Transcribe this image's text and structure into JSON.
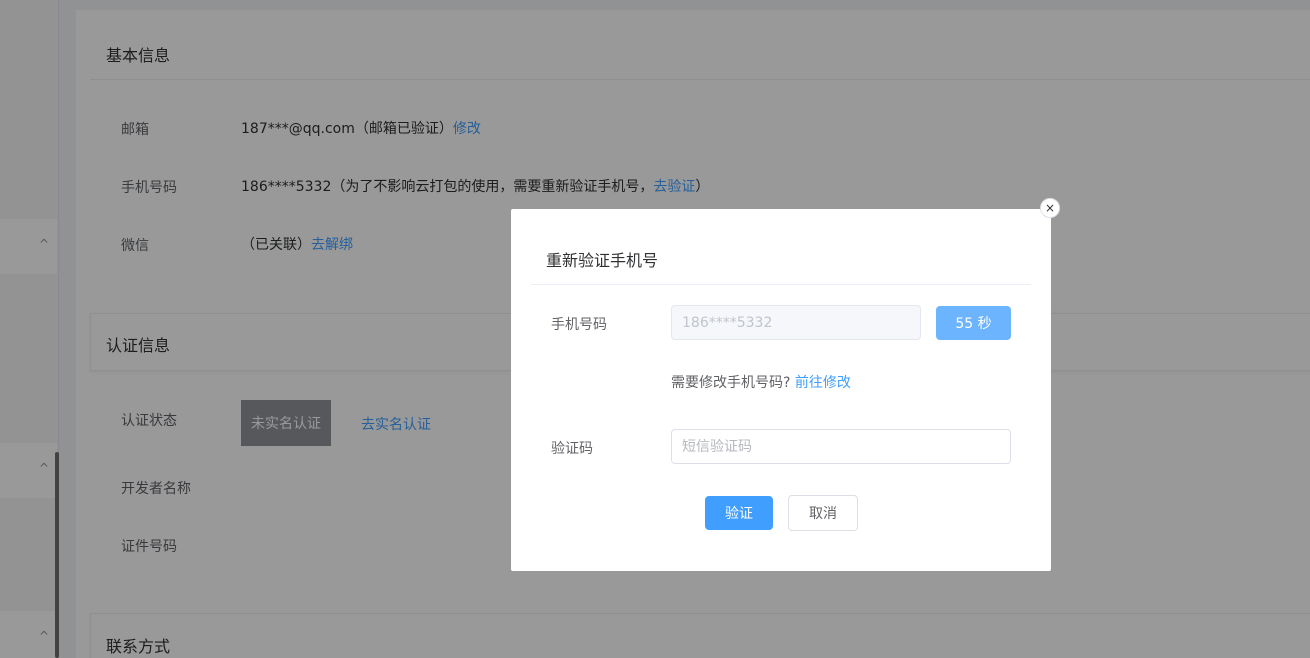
{
  "basic_info": {
    "title": "基本信息",
    "email": {
      "label": "邮箱",
      "value": "187***@qq.com",
      "status": "（邮箱已验证）",
      "action": "修改"
    },
    "phone": {
      "label": "手机号码",
      "value": "186****5332",
      "note_prefix": "（为了不影响云打包的使用，需要重新验证手机号，",
      "action": "去验证",
      "note_suffix": "）"
    },
    "wechat": {
      "label": "微信",
      "status": "（已关联）",
      "action": "去解绑"
    }
  },
  "cert_info": {
    "title": "认证信息",
    "status_label": "认证状态",
    "status_value": "未实名认证",
    "status_action": "去实名认证",
    "developer_label": "开发者名称",
    "id_label": "证件号码"
  },
  "contact": {
    "title": "联系方式"
  },
  "sidebar": {
    "chevrons": [
      "^",
      "^",
      "^"
    ]
  },
  "dialog": {
    "title": "重新验证手机号",
    "close_glyph": "×",
    "phone_label": "手机号码",
    "phone_value": "186****5332",
    "countdown_label": "55 秒",
    "hint_text": "需要修改手机号码?",
    "hint_link": "前往修改",
    "code_label": "验证码",
    "code_placeholder": "短信验证码",
    "code_value": "",
    "confirm_label": "验证",
    "cancel_label": "取消"
  },
  "colors": {
    "accent": "#409eff",
    "overlay": "rgba(0,0,0,0.4)",
    "status_tag": "#909399"
  }
}
